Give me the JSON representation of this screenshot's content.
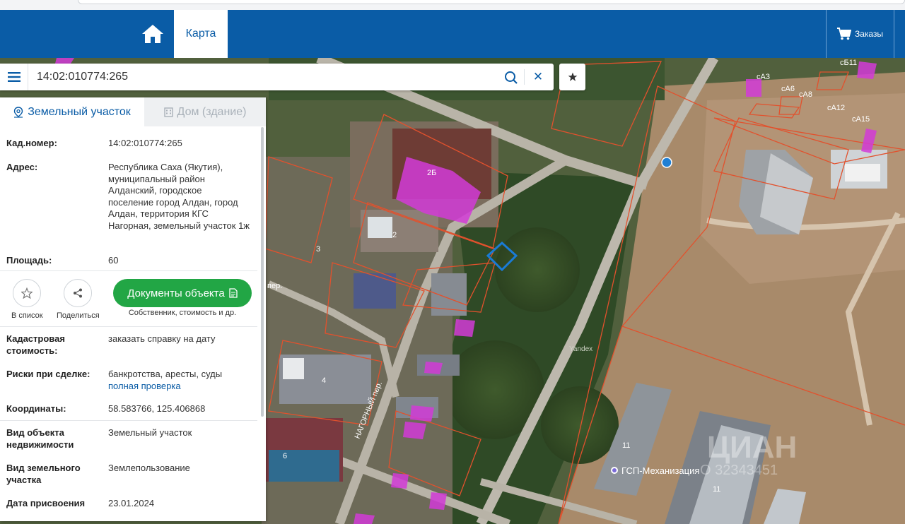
{
  "header": {
    "nav_tab": "Карта",
    "orders_label": "Заказы",
    "brand_color": "#0a5ca6"
  },
  "search": {
    "value": "14:02:010774:265"
  },
  "map_labels": {
    "plot_2b": "2Б",
    "plot_2": "2",
    "plot_3": "3",
    "plot_4": "4",
    "plot_6": "6",
    "plot_11a": "11",
    "plot_11b": "11",
    "ca3": "сА3",
    "ca6": "сА6",
    "ca8": "сА8",
    "ca12": "сА12",
    "ca15": "сА15",
    "cb11": "сБ11",
    "street_nagorny": "НАГОРНЫЙ пер.",
    "street_per": "пер.",
    "poi": "ГСП-Механизация",
    "yandex": "Yandex",
    "watermark": "ЦИАН",
    "phone_watermark": "О 32343451"
  },
  "panel": {
    "tab_land": "Земельный участок",
    "tab_house": "Дом (здание)",
    "cad_label": "Кад.номер:",
    "cad_value": "14:02:010774:265",
    "addr_label": "Адрес:",
    "addr_value": "Республика Саха (Якутия), муниципальный район Алданский, городское поселение город Алдан, город Алдан, территория КГС Нагорная, земельный участок 1ж",
    "area_label": "Площадь:",
    "area_value": "60",
    "action_list": "В список",
    "action_share": "Поделиться",
    "docs_button": "Документы объекта",
    "docs_sub": "Собственник, стоимость и др.",
    "cost_label": "Кадастровая стоимость:",
    "cost_link": "заказать справку на дату",
    "risk_label": "Риски при сделке:",
    "risk_value": "банкротства, аресты, суды",
    "risk_link": "полная проверка",
    "coord_label": "Координаты:",
    "coord_value": "58.583766, 125.406868",
    "type_label": "Вид объекта недвижимости",
    "type_value": "Земельный участок",
    "land_label": "Вид земельного участка",
    "land_value": "Землепользование",
    "date_label": "Дата присвоения",
    "date_value": "23.01.2024"
  }
}
